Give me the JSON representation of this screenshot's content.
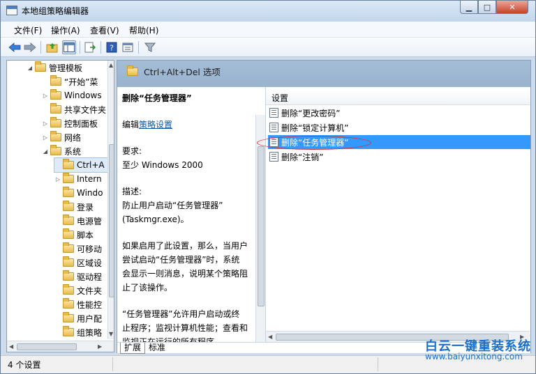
{
  "window": {
    "title": "本地组策略编辑器"
  },
  "caption_buttons": {
    "minimize": "▁",
    "maximize": "□",
    "close": "✕"
  },
  "colors": {
    "selection": "#3399ff",
    "header": "#9ab3ce",
    "link": "#0b57a8",
    "annotation": "#d23030"
  },
  "menu": {
    "items": [
      "文件(F)",
      "操作(A)",
      "查看(V)",
      "帮助(H)"
    ]
  },
  "toolbar": {
    "back": "back-arrow-icon",
    "forward": "forward-arrow-icon",
    "up": "up-folder-icon",
    "show_hide": "console-tree-icon",
    "export": "export-list-icon",
    "help": "help-icon",
    "properties": "properties-icon",
    "filter": "filter-icon"
  },
  "tree": {
    "items": [
      {
        "label": "管理模板"
      },
      {
        "label": "“开始”菜"
      },
      {
        "label": "Windows"
      },
      {
        "label": "共享文件夹"
      },
      {
        "label": "控制面板"
      },
      {
        "label": "网络"
      },
      {
        "label": "系统"
      },
      {
        "label": "Ctrl+A"
      },
      {
        "label": "Intern"
      },
      {
        "label": "Windo"
      },
      {
        "label": "登录"
      },
      {
        "label": "电源管"
      },
      {
        "label": "脚本"
      },
      {
        "label": "可移动"
      },
      {
        "label": "区域设"
      },
      {
        "label": "驱动程"
      },
      {
        "label": "文件夹"
      },
      {
        "label": "性能控"
      },
      {
        "label": "用户配"
      },
      {
        "label": "组策略"
      }
    ]
  },
  "header": {
    "title": "Ctrl+Alt+Del 选项"
  },
  "description": {
    "title": "删除“任务管理器”",
    "edit_prefix": "编辑",
    "edit_link": "策略设置",
    "requirements_label": "要求:",
    "requirements_value": "至少 Windows 2000",
    "desc_label": "描述:",
    "desc_line1": "防止用户启动“任务管理器”",
    "desc_line2": "(Taskmgr.exe)。",
    "para2_line1": "如果启用了此设置，那么，当用户",
    "para2_line2": "尝试启动“任务管理器”时，系统",
    "para2_line3": "会显示一则消息，说明某个策略阻",
    "para2_line4": "止了该操作。",
    "para3_line1": "“任务管理器”允许用户启动或终",
    "para3_line2": "止程序；监视计算机性能；查看和",
    "para3_line3": "监视正在运行的所有程序"
  },
  "list": {
    "column": "设置",
    "rows": [
      {
        "label": "删除“更改密码”"
      },
      {
        "label": "删除“锁定计算机”"
      },
      {
        "label": "删除“任务管理器”"
      },
      {
        "label": "删除“注销”"
      }
    ]
  },
  "tabs": [
    "扩展",
    "标准"
  ],
  "status": {
    "text": "4 个设置"
  },
  "watermark": {
    "line1": "白云一键重装系统",
    "line2": "www.baiyunxitong.com"
  }
}
